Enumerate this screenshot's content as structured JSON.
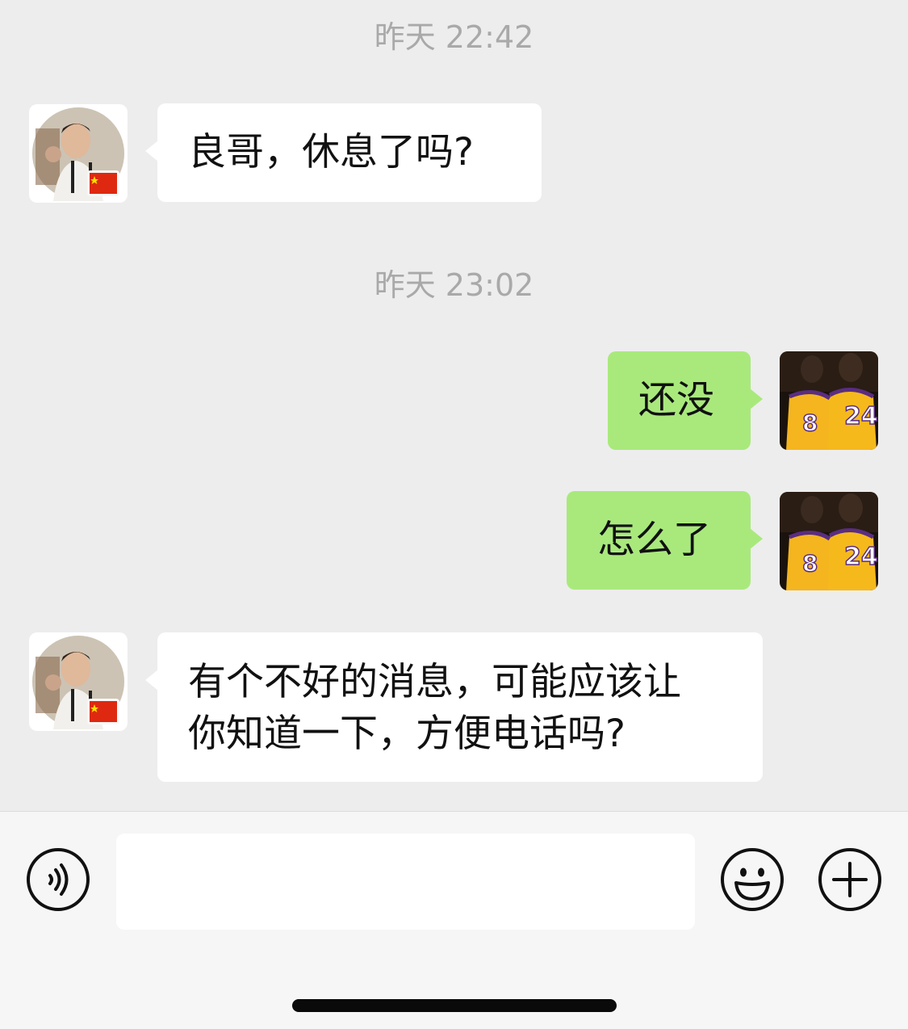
{
  "conversation": {
    "timestamps": [
      "昨天 22:42",
      "昨天 23:02"
    ],
    "messages": [
      {
        "sender": "contact",
        "text": "良哥，休息了吗?"
      },
      {
        "sender": "me",
        "text": "还没"
      },
      {
        "sender": "me",
        "text": "怎么了"
      },
      {
        "sender": "contact",
        "text": "有个不好的消息，可能应该让\n你知道一下，方便电话吗?"
      }
    ]
  },
  "avatars": {
    "contact": "contact-avatar-photo",
    "me": "basketball-jerseys-8-24"
  },
  "input_bar": {
    "text_value": "",
    "icons": [
      "voice-icon",
      "emoji-icon",
      "plus-icon"
    ]
  },
  "colors": {
    "background": "#ededed",
    "incoming_bubble": "#ffffff",
    "outgoing_bubble": "#a9e97c",
    "timestamp_text": "#a9a9a9",
    "input_bar": "#f6f6f6"
  }
}
